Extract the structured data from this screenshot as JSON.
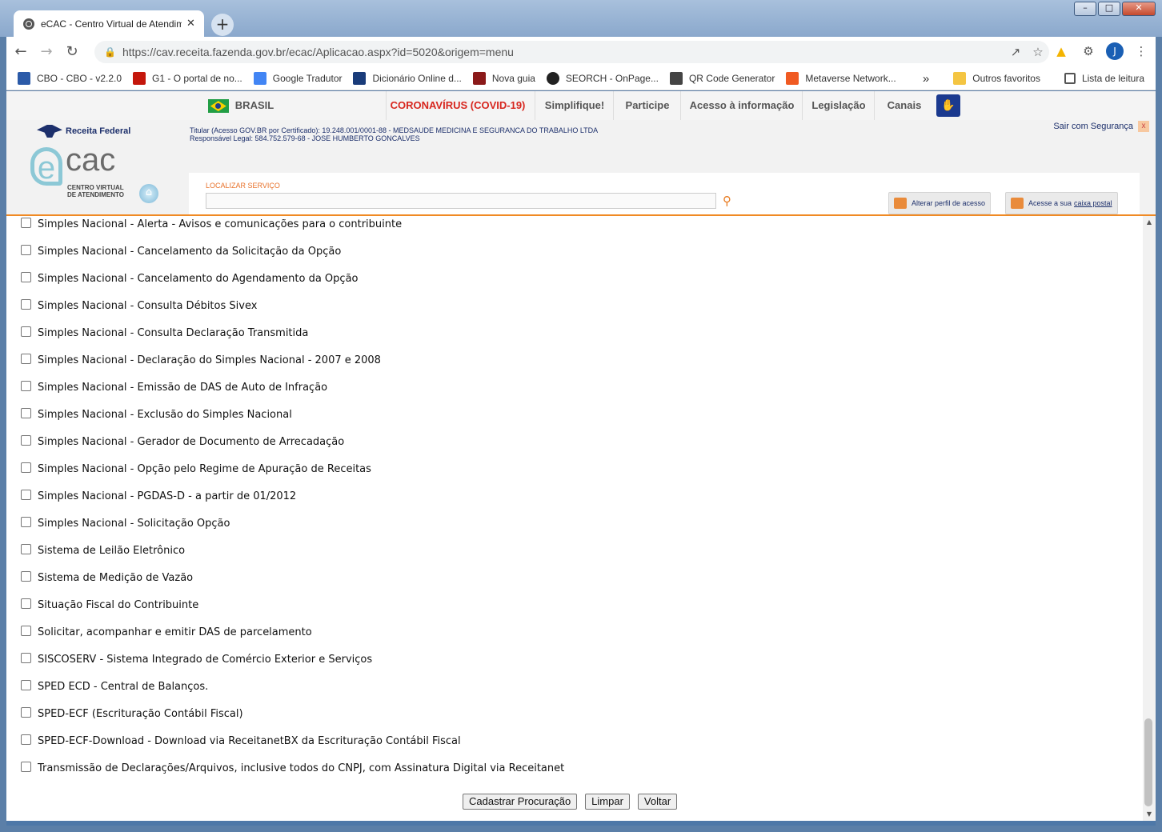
{
  "browser": {
    "tab_title": "eCAC - Centro Virtual de Atendim",
    "tab_close": "✕",
    "new_tab": "+",
    "window_controls": [
      "–",
      "□",
      "✕"
    ],
    "url": "https://cav.receita.fazenda.gov.br/ecac/Aplicacao.aspx?id=5020&origem=menu",
    "avatar_letter": "J",
    "bookmarks": [
      {
        "label": "CBO - CBO - v2.2.0",
        "color": "#2b5aa8"
      },
      {
        "label": "G1 - O portal de no...",
        "color": "#c4170c"
      },
      {
        "label": "Google Tradutor",
        "color": "#4285f4"
      },
      {
        "label": "Dicionário Online d...",
        "color": "#1a3c7a"
      },
      {
        "label": "Nova guia",
        "color": "#8b1a1a"
      },
      {
        "label": "SEORCH - OnPage...",
        "color": "#222222"
      },
      {
        "label": "QR Code Generator",
        "color": "#444444"
      },
      {
        "label": "Metaverse Network...",
        "color": "#f05a22"
      }
    ],
    "bookmarks_overflow": "»",
    "other_favorites": "Outros favoritos",
    "reading_list": "Lista de leitura"
  },
  "govbar": {
    "country": "BRASIL",
    "items": [
      "CORONAVÍRUS (COVID-19)",
      "Simplifique!",
      "Participe",
      "Acesso à informação",
      "Legislação",
      "Canais"
    ],
    "covid_color": "#d7261e"
  },
  "header": {
    "rf_logo": "Receita Federal",
    "ecac_e": "e",
    "ecac_cac": "cac",
    "ecac_sub": "CENTRO VIRTUAL DE ATENDIMENTO",
    "titular_line1": "Titular (Acesso GOV.BR por Certificado): 19.248.001/0001-88 - MEDSAUDE MEDICINA E SEGURANCA DO TRABALHO LTDA",
    "titular_line2": "Responsável Legal: 584.752.579-68 - JOSE HUMBERTO GONCALVES",
    "sair": "Sair com Segurança",
    "sair_x": "x",
    "search_label": "LOCALIZAR SERVIÇO",
    "alterar_perfil": "Alterar perfil de acesso",
    "caixa_prefix": "Acesse a sua",
    "caixa_link": "caixa postal"
  },
  "services": [
    "Simples Nacional - Alerta - Avisos e comunicações para o contribuinte",
    "Simples Nacional - Cancelamento da Solicitação da Opção",
    "Simples Nacional - Cancelamento do Agendamento da Opção",
    "Simples Nacional - Consulta Débitos Sivex",
    "Simples Nacional - Consulta Declaração Transmitida",
    "Simples Nacional - Declaração do Simples Nacional - 2007 e 2008",
    "Simples Nacional - Emissão de DAS de Auto de Infração",
    "Simples Nacional - Exclusão do Simples Nacional",
    "Simples Nacional - Gerador de Documento de Arrecadação",
    "Simples Nacional - Opção pelo Regime de Apuração de Receitas",
    "Simples Nacional - PGDAS-D - a partir de 01/2012",
    "Simples Nacional - Solicitação Opção",
    "Sistema de Leilão Eletrônico",
    "Sistema de Medição de Vazão",
    "Situação Fiscal do Contribuinte",
    "Solicitar, acompanhar e emitir DAS de parcelamento",
    "SISCOSERV - Sistema Integrado de Comércio Exterior e Serviços",
    "SPED ECD - Central de Balanços.",
    "SPED-ECF (Escrituração Contábil Fiscal)",
    "SPED-ECF-Download - Download via ReceitanetBX da Escrituração Contábil Fiscal",
    "Transmissão de Declarações/Arquivos, inclusive todos do CNPJ, com Assinatura Digital via Receitanet"
  ],
  "actions": {
    "cadastrar": "Cadastrar Procuração",
    "limpar": "Limpar",
    "voltar": "Voltar"
  }
}
